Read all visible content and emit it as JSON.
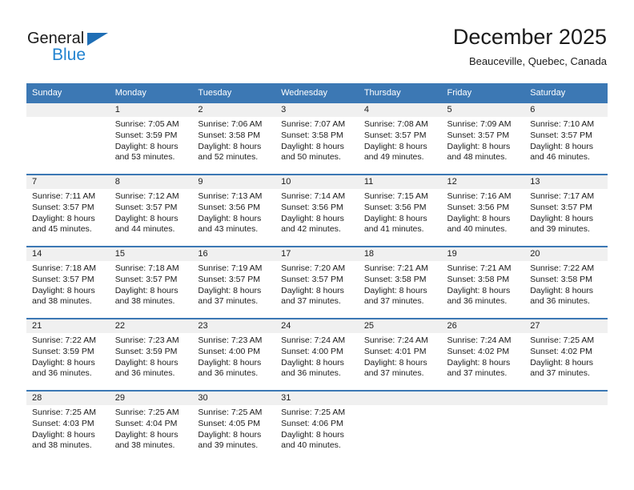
{
  "brand": {
    "name_part1": "General",
    "name_part2": "Blue",
    "accent_color": "#2283d0",
    "triangle_color": "#1f6eb5"
  },
  "header": {
    "title": "December 2025",
    "subtitle": "Beauceville, Quebec, Canada"
  },
  "calendar": {
    "header_background": "#3c78b4",
    "daynum_band_background": "#f0f0f0",
    "weekdays": [
      "Sunday",
      "Monday",
      "Tuesday",
      "Wednesday",
      "Thursday",
      "Friday",
      "Saturday"
    ],
    "weeks": [
      [
        {
          "day": "",
          "sunrise": "",
          "sunset": "",
          "daylight_line1": "",
          "daylight_line2": "",
          "empty": true
        },
        {
          "day": "1",
          "sunrise": "Sunrise: 7:05 AM",
          "sunset": "Sunset: 3:59 PM",
          "daylight_line1": "Daylight: 8 hours",
          "daylight_line2": "and 53 minutes."
        },
        {
          "day": "2",
          "sunrise": "Sunrise: 7:06 AM",
          "sunset": "Sunset: 3:58 PM",
          "daylight_line1": "Daylight: 8 hours",
          "daylight_line2": "and 52 minutes."
        },
        {
          "day": "3",
          "sunrise": "Sunrise: 7:07 AM",
          "sunset": "Sunset: 3:58 PM",
          "daylight_line1": "Daylight: 8 hours",
          "daylight_line2": "and 50 minutes."
        },
        {
          "day": "4",
          "sunrise": "Sunrise: 7:08 AM",
          "sunset": "Sunset: 3:57 PM",
          "daylight_line1": "Daylight: 8 hours",
          "daylight_line2": "and 49 minutes."
        },
        {
          "day": "5",
          "sunrise": "Sunrise: 7:09 AM",
          "sunset": "Sunset: 3:57 PM",
          "daylight_line1": "Daylight: 8 hours",
          "daylight_line2": "and 48 minutes."
        },
        {
          "day": "6",
          "sunrise": "Sunrise: 7:10 AM",
          "sunset": "Sunset: 3:57 PM",
          "daylight_line1": "Daylight: 8 hours",
          "daylight_line2": "and 46 minutes."
        }
      ],
      [
        {
          "day": "7",
          "sunrise": "Sunrise: 7:11 AM",
          "sunset": "Sunset: 3:57 PM",
          "daylight_line1": "Daylight: 8 hours",
          "daylight_line2": "and 45 minutes."
        },
        {
          "day": "8",
          "sunrise": "Sunrise: 7:12 AM",
          "sunset": "Sunset: 3:57 PM",
          "daylight_line1": "Daylight: 8 hours",
          "daylight_line2": "and 44 minutes."
        },
        {
          "day": "9",
          "sunrise": "Sunrise: 7:13 AM",
          "sunset": "Sunset: 3:56 PM",
          "daylight_line1": "Daylight: 8 hours",
          "daylight_line2": "and 43 minutes."
        },
        {
          "day": "10",
          "sunrise": "Sunrise: 7:14 AM",
          "sunset": "Sunset: 3:56 PM",
          "daylight_line1": "Daylight: 8 hours",
          "daylight_line2": "and 42 minutes."
        },
        {
          "day": "11",
          "sunrise": "Sunrise: 7:15 AM",
          "sunset": "Sunset: 3:56 PM",
          "daylight_line1": "Daylight: 8 hours",
          "daylight_line2": "and 41 minutes."
        },
        {
          "day": "12",
          "sunrise": "Sunrise: 7:16 AM",
          "sunset": "Sunset: 3:56 PM",
          "daylight_line1": "Daylight: 8 hours",
          "daylight_line2": "and 40 minutes."
        },
        {
          "day": "13",
          "sunrise": "Sunrise: 7:17 AM",
          "sunset": "Sunset: 3:57 PM",
          "daylight_line1": "Daylight: 8 hours",
          "daylight_line2": "and 39 minutes."
        }
      ],
      [
        {
          "day": "14",
          "sunrise": "Sunrise: 7:18 AM",
          "sunset": "Sunset: 3:57 PM",
          "daylight_line1": "Daylight: 8 hours",
          "daylight_line2": "and 38 minutes."
        },
        {
          "day": "15",
          "sunrise": "Sunrise: 7:18 AM",
          "sunset": "Sunset: 3:57 PM",
          "daylight_line1": "Daylight: 8 hours",
          "daylight_line2": "and 38 minutes."
        },
        {
          "day": "16",
          "sunrise": "Sunrise: 7:19 AM",
          "sunset": "Sunset: 3:57 PM",
          "daylight_line1": "Daylight: 8 hours",
          "daylight_line2": "and 37 minutes."
        },
        {
          "day": "17",
          "sunrise": "Sunrise: 7:20 AM",
          "sunset": "Sunset: 3:57 PM",
          "daylight_line1": "Daylight: 8 hours",
          "daylight_line2": "and 37 minutes."
        },
        {
          "day": "18",
          "sunrise": "Sunrise: 7:21 AM",
          "sunset": "Sunset: 3:58 PM",
          "daylight_line1": "Daylight: 8 hours",
          "daylight_line2": "and 37 minutes."
        },
        {
          "day": "19",
          "sunrise": "Sunrise: 7:21 AM",
          "sunset": "Sunset: 3:58 PM",
          "daylight_line1": "Daylight: 8 hours",
          "daylight_line2": "and 36 minutes."
        },
        {
          "day": "20",
          "sunrise": "Sunrise: 7:22 AM",
          "sunset": "Sunset: 3:58 PM",
          "daylight_line1": "Daylight: 8 hours",
          "daylight_line2": "and 36 minutes."
        }
      ],
      [
        {
          "day": "21",
          "sunrise": "Sunrise: 7:22 AM",
          "sunset": "Sunset: 3:59 PM",
          "daylight_line1": "Daylight: 8 hours",
          "daylight_line2": "and 36 minutes."
        },
        {
          "day": "22",
          "sunrise": "Sunrise: 7:23 AM",
          "sunset": "Sunset: 3:59 PM",
          "daylight_line1": "Daylight: 8 hours",
          "daylight_line2": "and 36 minutes."
        },
        {
          "day": "23",
          "sunrise": "Sunrise: 7:23 AM",
          "sunset": "Sunset: 4:00 PM",
          "daylight_line1": "Daylight: 8 hours",
          "daylight_line2": "and 36 minutes."
        },
        {
          "day": "24",
          "sunrise": "Sunrise: 7:24 AM",
          "sunset": "Sunset: 4:00 PM",
          "daylight_line1": "Daylight: 8 hours",
          "daylight_line2": "and 36 minutes."
        },
        {
          "day": "25",
          "sunrise": "Sunrise: 7:24 AM",
          "sunset": "Sunset: 4:01 PM",
          "daylight_line1": "Daylight: 8 hours",
          "daylight_line2": "and 37 minutes."
        },
        {
          "day": "26",
          "sunrise": "Sunrise: 7:24 AM",
          "sunset": "Sunset: 4:02 PM",
          "daylight_line1": "Daylight: 8 hours",
          "daylight_line2": "and 37 minutes."
        },
        {
          "day": "27",
          "sunrise": "Sunrise: 7:25 AM",
          "sunset": "Sunset: 4:02 PM",
          "daylight_line1": "Daylight: 8 hours",
          "daylight_line2": "and 37 minutes."
        }
      ],
      [
        {
          "day": "28",
          "sunrise": "Sunrise: 7:25 AM",
          "sunset": "Sunset: 4:03 PM",
          "daylight_line1": "Daylight: 8 hours",
          "daylight_line2": "and 38 minutes."
        },
        {
          "day": "29",
          "sunrise": "Sunrise: 7:25 AM",
          "sunset": "Sunset: 4:04 PM",
          "daylight_line1": "Daylight: 8 hours",
          "daylight_line2": "and 38 minutes."
        },
        {
          "day": "30",
          "sunrise": "Sunrise: 7:25 AM",
          "sunset": "Sunset: 4:05 PM",
          "daylight_line1": "Daylight: 8 hours",
          "daylight_line2": "and 39 minutes."
        },
        {
          "day": "31",
          "sunrise": "Sunrise: 7:25 AM",
          "sunset": "Sunset: 4:06 PM",
          "daylight_line1": "Daylight: 8 hours",
          "daylight_line2": "and 40 minutes."
        },
        {
          "day": "",
          "sunrise": "",
          "sunset": "",
          "daylight_line1": "",
          "daylight_line2": "",
          "empty": true
        },
        {
          "day": "",
          "sunrise": "",
          "sunset": "",
          "daylight_line1": "",
          "daylight_line2": "",
          "empty": true
        },
        {
          "day": "",
          "sunrise": "",
          "sunset": "",
          "daylight_line1": "",
          "daylight_line2": "",
          "empty": true
        }
      ]
    ]
  }
}
